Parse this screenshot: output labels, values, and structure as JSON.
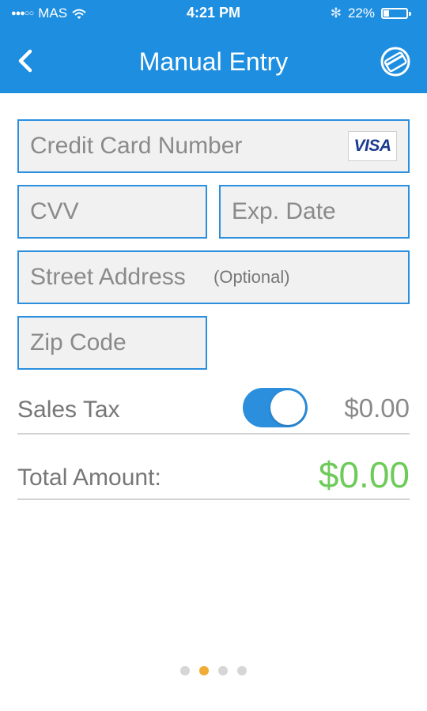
{
  "status_bar": {
    "signal": "●●●○○",
    "carrier": "MAS",
    "time": "4:21 PM",
    "bluetooth": "✻",
    "battery_text": "22%",
    "battery_level": 0.22
  },
  "nav": {
    "title": "Manual Entry",
    "back_icon": "chevron-left-icon",
    "card_icon": "credit-card-icon"
  },
  "form": {
    "card_number": {
      "placeholder": "Credit Card Number",
      "value": ""
    },
    "card_brand": "VISA",
    "cvv": {
      "placeholder": "CVV",
      "value": ""
    },
    "exp_date": {
      "placeholder": "Exp. Date",
      "value": ""
    },
    "street": {
      "placeholder": "Street Address",
      "value": "",
      "hint": "(Optional)"
    },
    "zip": {
      "placeholder": "Zip Code",
      "value": ""
    }
  },
  "sales_tax": {
    "label": "Sales Tax",
    "enabled": true,
    "amount": "$0.00"
  },
  "total": {
    "label": "Total Amount:",
    "amount": "$0.00"
  },
  "pager": {
    "count": 4,
    "active_index": 1
  },
  "colors": {
    "brand_blue": "#1e8ee0",
    "field_border": "#2b8fde",
    "total_green": "#6ecb5a",
    "pager_active": "#f0ac34"
  }
}
